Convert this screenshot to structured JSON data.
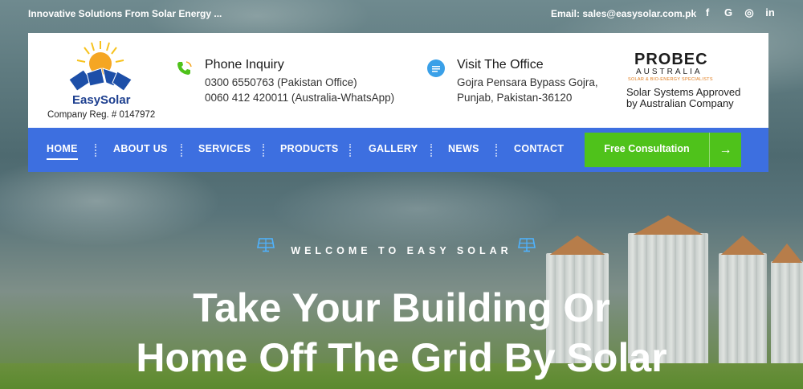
{
  "topbar": {
    "tagline": "Innovative Solutions From Solar Energy ...",
    "email": "Email: sales@easysolar.com.pk",
    "socials": [
      {
        "icon": "facebook-icon",
        "glyph": "f"
      },
      {
        "icon": "google-icon",
        "glyph": "G"
      },
      {
        "icon": "instagram-icon",
        "glyph": "◎"
      },
      {
        "icon": "linkedin-icon",
        "glyph": "in"
      }
    ]
  },
  "header": {
    "logo_text": "EasySolar",
    "company_reg": "Company Reg. # 0147972",
    "phone": {
      "icon": "phone-icon",
      "title": "Phone Inquiry",
      "lines": [
        "0300 6550763 (Pakistan Office)",
        "0060 412 420011 (Australia-WhatsApp)"
      ]
    },
    "office": {
      "icon": "chat-bubble-icon",
      "title": "Visit The Office",
      "lines": [
        "Gojra Pensara Bypass Gojra,",
        "Punjab, Pakistan-36120"
      ]
    },
    "partner": {
      "name": "PROBEC",
      "country": "AUSTRALIA",
      "tagline": "SOLAR & BIO-ENERGY SPECIALISTS",
      "description_line1": "Solar Systems Approved",
      "description_line2": "by Australian Company"
    }
  },
  "nav": {
    "items": [
      {
        "label": "HOME",
        "active": true
      },
      {
        "label": "ABOUT US",
        "active": false
      },
      {
        "label": "SERVICES",
        "active": false
      },
      {
        "label": "PRODUCTS",
        "active": false
      },
      {
        "label": "GALLERY",
        "active": false
      },
      {
        "label": "NEWS",
        "active": false
      },
      {
        "label": "CONTACT",
        "active": false
      }
    ],
    "cta_label": "Free Consultation",
    "cta_arrow": "→"
  },
  "hero": {
    "kicker": "WELCOME TO EASY SOLAR",
    "title_line1": "Take Your Building Or",
    "title_line2": "Home Off The Grid By Solar"
  },
  "colors": {
    "nav_bg": "#3d6fe0",
    "cta_bg": "#4fc21b",
    "accent_orange": "#e07b1a",
    "icon_blue": "#3aa0e8"
  }
}
